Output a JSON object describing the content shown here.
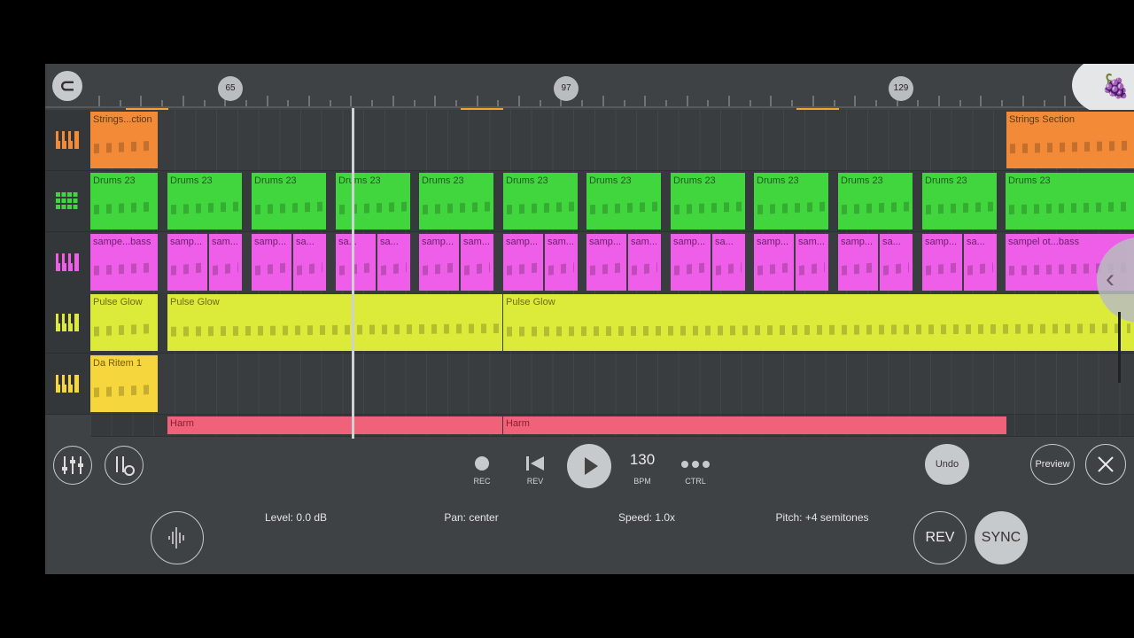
{
  "ruler": {
    "markers": [
      "65",
      "97",
      "129"
    ]
  },
  "tracks": [
    {
      "icon": "piano-icon",
      "color": "#f28a37",
      "clips": [
        {
          "label": "Strings...ction",
          "start": 0,
          "len": 76
        },
        {
          "label": "Strings Section",
          "start": 1034,
          "len": 144
        }
      ]
    },
    {
      "icon": "drum-pad-icon",
      "color": "#42d63e",
      "clips": [
        {
          "label": "Drums 23"
        },
        {
          "label": "Drums 23"
        },
        {
          "label": "Drums 23"
        },
        {
          "label": "Drums 23"
        },
        {
          "label": "Drums 23"
        },
        {
          "label": "Drums 23"
        },
        {
          "label": "Drums 23"
        },
        {
          "label": "Drums 23"
        },
        {
          "label": "Drums 23"
        },
        {
          "label": "Drums 23"
        },
        {
          "label": "Drums 23"
        },
        {
          "label": "Drums 23"
        }
      ]
    },
    {
      "icon": "piano-icon",
      "color": "#ee5ee8",
      "clips": [
        {
          "label": "sampe...bass"
        },
        {
          "label": "samp..."
        },
        {
          "label": "sam..."
        },
        {
          "label": "samp..."
        },
        {
          "label": "sa..."
        },
        {
          "label": "sa..."
        },
        {
          "label": "sa..."
        },
        {
          "label": "samp..."
        },
        {
          "label": "sam..."
        },
        {
          "label": "samp..."
        },
        {
          "label": "sam..."
        },
        {
          "label": "samp..."
        },
        {
          "label": "sam..."
        },
        {
          "label": "samp..."
        },
        {
          "label": "sa..."
        },
        {
          "label": "samp..."
        },
        {
          "label": "sam..."
        },
        {
          "label": "samp..."
        },
        {
          "label": "sa..."
        },
        {
          "label": "samp..."
        },
        {
          "label": "sa..."
        },
        {
          "label": "sampel ot...bass"
        }
      ]
    },
    {
      "icon": "piano-icon",
      "color": "#dcea3a",
      "clips": [
        {
          "label": "Pulse Glow"
        },
        {
          "label": "Pulse Glow"
        },
        {
          "label": "Pulse Glow"
        }
      ]
    },
    {
      "icon": "piano-icon",
      "color": "#f5d63c",
      "clips": [
        {
          "label": "Da Ritem 1"
        }
      ]
    },
    {
      "icon": "",
      "color": "#f0617a",
      "clips": [
        {
          "label": "Harm"
        },
        {
          "label": "Harm"
        }
      ]
    }
  ],
  "transport": {
    "rec_label": "REC",
    "rev_label": "REV",
    "bpm_value": "130",
    "bpm_label": "BPM",
    "ctrl_label": "CTRL",
    "undo_label": "Undo",
    "preview_label": "Preview",
    "level_label": "Level: 0.0 dB",
    "pan_label": "Pan: center",
    "speed_label": "Speed: 1.0x",
    "pitch_label": "Pitch: +4 semitones",
    "rev_button_label": "REV",
    "sync_button_label": "SYNC",
    "level_value": 0.85,
    "pan_value": 0.5,
    "speed_value": 0.5,
    "pitch_value": 0.6
  }
}
